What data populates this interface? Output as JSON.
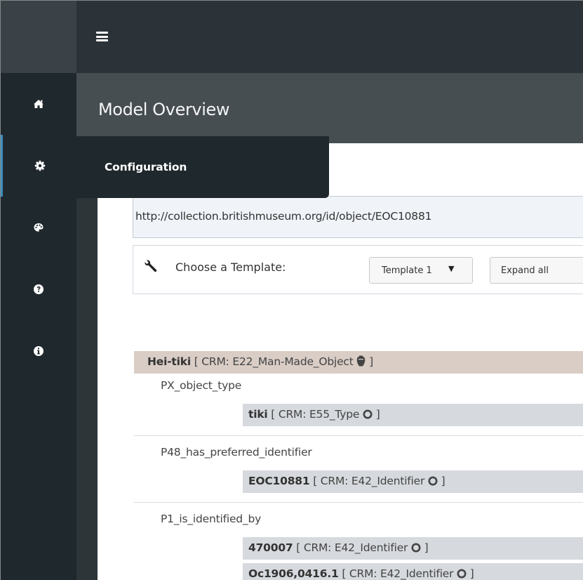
{
  "header": {
    "menu_icon": "hamburger-icon"
  },
  "sidebar": {
    "items": [
      {
        "icon": "home-icon",
        "label": "Home"
      },
      {
        "icon": "gear-icon",
        "label": "Configuration",
        "active": true
      },
      {
        "icon": "palette-icon",
        "label": "Styles"
      },
      {
        "icon": "question-icon",
        "label": "Help"
      },
      {
        "icon": "info-icon",
        "label": "About"
      }
    ],
    "tooltip": "Configuration"
  },
  "page": {
    "title": "Model Overview"
  },
  "uri_box": {
    "value": "http://collection.britishmuseum.org/id/object/EOC10881"
  },
  "toolbar": {
    "choose_label": "Choose a Template:",
    "template_selected": "Template 1",
    "expand_label": "Expand all"
  },
  "tree": {
    "root": {
      "label": "Hei-tiki",
      "class": " [ CRM: E22_Man-Made_Object ",
      "close": " ]",
      "icon": "amphora-icon"
    },
    "groups": [
      {
        "property": "PX_object_type",
        "children": [
          {
            "label": "tiki",
            "class": " [ CRM: E55_Type ",
            "close": " ]",
            "icon": "circle-outline-icon"
          }
        ]
      },
      {
        "property": "P48_has_preferred_identifier",
        "children": [
          {
            "label": "EOC10881",
            "class": " [ CRM: E42_Identifier ",
            "close": " ]",
            "icon": "circle-outline-icon"
          }
        ]
      },
      {
        "property": "P1_is_identified_by",
        "children": [
          {
            "label": "470007",
            "class": " [ CRM: E42_Identifier ",
            "close": " ]",
            "icon": "circle-outline-icon"
          },
          {
            "label": "Oc1906,0416.1",
            "class": " [ CRM: E42_Identifier ",
            "close": " ]",
            "icon": "circle-outline-icon"
          }
        ]
      }
    ]
  },
  "colors": {
    "topbar": "#2b3338",
    "sidebar": "#1f282d",
    "accent": "#3c8dbc",
    "root_row": "#d9cdc6",
    "node_row": "#d6d9dd"
  }
}
